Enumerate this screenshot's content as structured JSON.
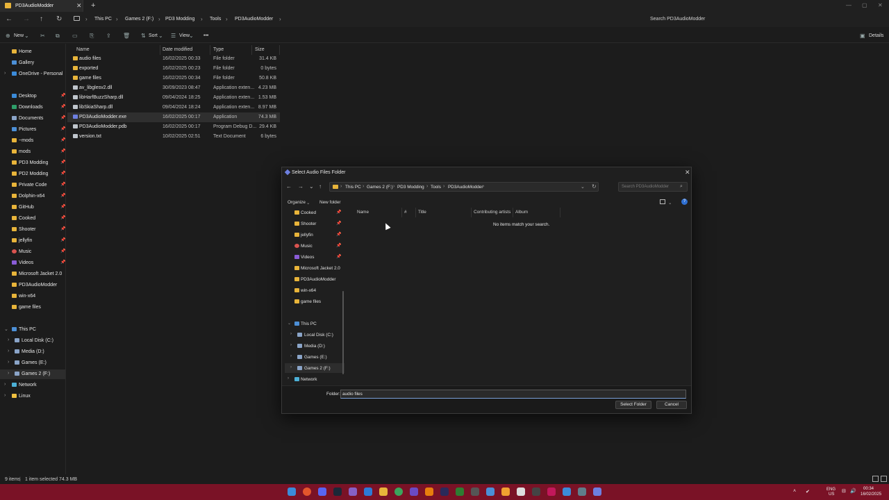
{
  "window": {
    "tab_title": "PD3AudioModder"
  },
  "breadcrumb": [
    "This PC",
    "Games 2 (F:)",
    "PD3 Modding",
    "Tools",
    "PD3AudioModder"
  ],
  "search_placeholder": "Search PD3AudioModder",
  "toolbar": {
    "new": "New",
    "sort": "Sort",
    "view": "View",
    "more": "•••",
    "details": "Details"
  },
  "nav": {
    "home": "Home",
    "gallery": "Gallery",
    "onedrive": "OneDrive - Personal",
    "desktop": "Desktop",
    "downloads": "Downloads",
    "documents": "Documents",
    "pictures": "Pictures",
    "tilde_mods": "~mods",
    "mods": "mods",
    "pd3_modding": "PD3 Modding",
    "pd2_modding": "PD2 Modding",
    "private_code": "Private Code",
    "dolphin": "Dolphin-x64",
    "github": "GitHub",
    "cooked": "Cooked",
    "shooter": "Shooter",
    "jellyfin": "jellyfin",
    "music": "Music",
    "videos": "Videos",
    "ms_jacket": "Microsoft Jacket 2.0",
    "pd3audiomodder": "PD3AudioModder",
    "win_x64": "win-x64",
    "game_files": "game files",
    "this_pc": "This PC",
    "local_disk": "Local Disk (C:)",
    "media": "Media (D:)",
    "games": "Games (E:)",
    "games2": "Games 2 (F:)",
    "network": "Network",
    "linux": "Linux"
  },
  "file_columns": {
    "name": "Name",
    "date": "Date modified",
    "type": "Type",
    "size": "Size"
  },
  "files": [
    {
      "name": "audio files",
      "date": "16/02/2025 00:33",
      "type": "File folder",
      "size": "31.4 KB",
      "kind": "folder"
    },
    {
      "name": "exported",
      "date": "16/02/2025 00:23",
      "type": "File folder",
      "size": "0 bytes",
      "kind": "folder"
    },
    {
      "name": "game files",
      "date": "16/02/2025 00:34",
      "type": "File folder",
      "size": "50.8 KB",
      "kind": "folder"
    },
    {
      "name": "av_libglesv2.dll",
      "date": "30/09/2023 08:47",
      "type": "Application exten...",
      "size": "4.23 MB",
      "kind": "file"
    },
    {
      "name": "libHarfBuzzSharp.dll",
      "date": "09/04/2024 18:25",
      "type": "Application exten...",
      "size": "1.53 MB",
      "kind": "file"
    },
    {
      "name": "libSkiaSharp.dll",
      "date": "09/04/2024 18:24",
      "type": "Application exten...",
      "size": "8.97 MB",
      "kind": "file"
    },
    {
      "name": "PD3AudioModder.exe",
      "date": "16/02/2025 00:17",
      "type": "Application",
      "size": "74.3 MB",
      "kind": "exe"
    },
    {
      "name": "PD3AudioModder.pdb",
      "date": "16/02/2025 00:17",
      "type": "Program Debug D...",
      "size": "29.4 KB",
      "kind": "file"
    },
    {
      "name": "version.txt",
      "date": "10/02/2025 02:51",
      "type": "Text Document",
      "size": "6 bytes",
      "kind": "file"
    }
  ],
  "status": {
    "items": "9 items",
    "selected": "1 item selected  74.3 MB"
  },
  "dialog": {
    "title": "Select Audio Files Folder",
    "breadcrumb": [
      "This PC",
      "Games 2 (F:)",
      "PD3 Modding",
      "Tools",
      "PD3AudioModder"
    ],
    "search_placeholder": "Search PD3AudioModder",
    "organize": "Organize",
    "new_folder": "New folder",
    "tree": {
      "cooked": "Cooked",
      "shooter": "Shooter",
      "jellyfin": "jellyfin",
      "music": "Music",
      "videos": "Videos",
      "ms_jacket": "Microsoft Jacket 2.0",
      "pd3audiomodder": "PD3AudioModder",
      "win_x64": "win-x64",
      "game_files": "game files",
      "this_pc": "This PC",
      "local_disk": "Local Disk (C:)",
      "media": "Media (D:)",
      "games": "Games (E:)",
      "games2": "Games 2 (F:)",
      "network": "Network"
    },
    "columns": {
      "name": "Name",
      "num": "#",
      "title": "Title",
      "artists": "Contributing artists",
      "album": "Album"
    },
    "empty_message": "No items match your search.",
    "folder_label": "Folder:",
    "folder_value": "audio files",
    "select_button": "Select Folder",
    "cancel_button": "Cancel"
  },
  "tray": {
    "lang1": "ENG",
    "lang2": "US",
    "time": "00:34",
    "date": "16/02/2025"
  },
  "colors": {
    "folder": "#e8b43a",
    "taskbar": "#7a1226",
    "drive": "#8aa4c8",
    "accent": "#4c8fd6"
  }
}
